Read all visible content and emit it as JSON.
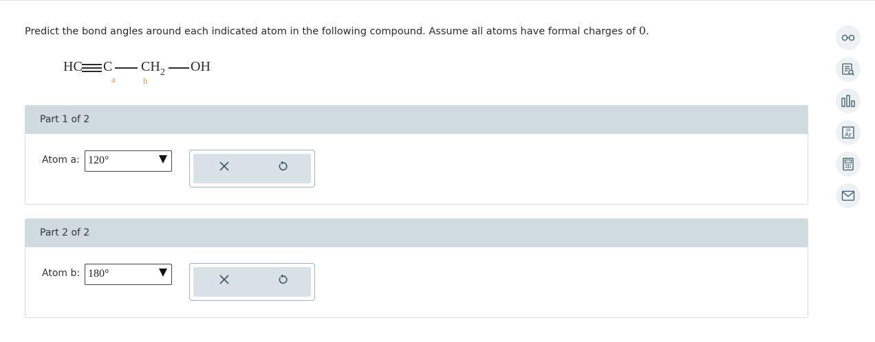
{
  "question": {
    "text": "Predict the bond angles around each indicated atom in the following compound. Assume all atoms have formal charges of",
    "value": "0",
    "end": "."
  },
  "molecule": {
    "hc": "HC",
    "c": "C",
    "ch": "CH",
    "sub": "2",
    "oh": "OH",
    "label_a": "a",
    "label_b": "b"
  },
  "parts": [
    {
      "title": "Part 1 of 2",
      "atom_label": "Atom a:",
      "selected": "120°"
    },
    {
      "title": "Part 2 of 2",
      "atom_label": "Atom b:",
      "selected": "180°"
    }
  ],
  "tools": [
    "glasses-icon",
    "reference-icon",
    "data-chart-icon",
    "periodic-table-icon",
    "calculator-icon",
    "mail-icon"
  ],
  "colors": {
    "accent_label": "#e8963c",
    "header_bg": "#d0dbe1",
    "icon": "#3b5766"
  }
}
